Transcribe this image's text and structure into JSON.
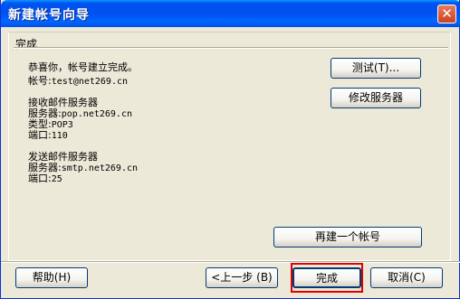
{
  "window": {
    "title": "新建帐号向导",
    "close_glyph": "✕"
  },
  "group": {
    "label": "完成"
  },
  "info": {
    "line1": "恭喜你，帐号建立完成。",
    "account_label": "帐号:",
    "account_value": "test@net269.cn",
    "incoming_title": "接收邮件服务器",
    "incoming_server_label": "服务器:",
    "incoming_server_value": "pop.net269.cn",
    "incoming_type_label": "类型:",
    "incoming_type_value": "POP3",
    "incoming_port_label": "端口:",
    "incoming_port_value": "110",
    "outgoing_title": "发送邮件服务器",
    "outgoing_server_label": "服务器:",
    "outgoing_server_value": "smtp.net269.cn",
    "outgoing_port_label": "端口:",
    "outgoing_port_value": "25"
  },
  "buttons": {
    "test": "测试(T)...",
    "modify_server": "修改服务器",
    "new_account": "再建一个帐号",
    "help": "帮助(H)",
    "back": "<上一步 (B)",
    "finish": "完成",
    "cancel": "取消(C)"
  },
  "colors": {
    "titlebar": "#0050ee",
    "highlight": "#e00000",
    "face": "#ece9d8"
  }
}
